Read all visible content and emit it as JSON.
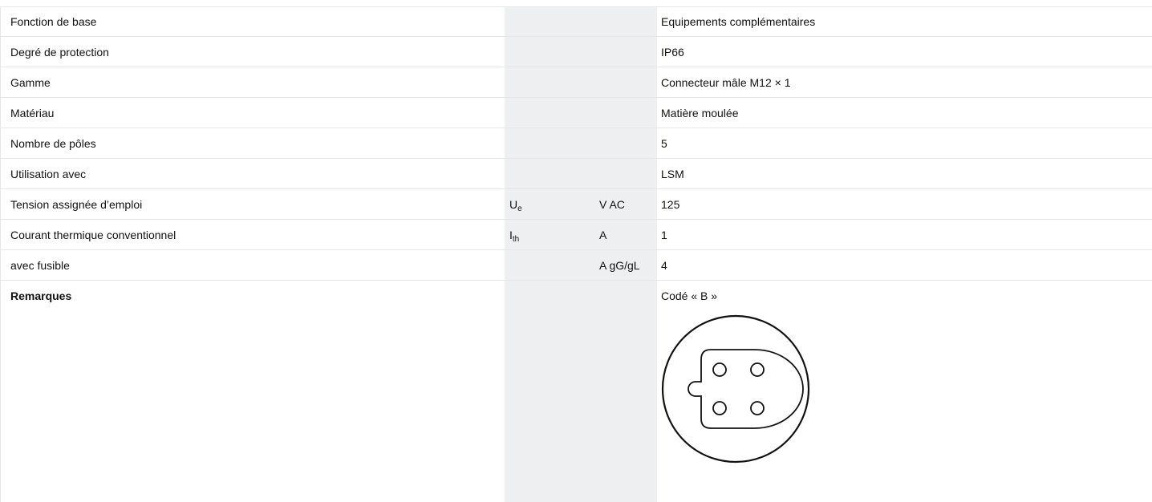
{
  "rows": [
    {
      "label": "Fonction de base",
      "value": "Equipements complémentaires"
    },
    {
      "label": "Degré de protection",
      "value": "IP66"
    },
    {
      "label": "Gamme",
      "value": "Connecteur mâle M12 × 1"
    },
    {
      "label": "Matériau",
      "value": "Matière moulée"
    },
    {
      "label": "Nombre de pôles",
      "value": "5"
    },
    {
      "label": "Utilisation avec",
      "value": "LSM"
    },
    {
      "label": "Tension assignée d’emploi",
      "symbol": "U",
      "symbol_sub": "e",
      "unit": "V AC",
      "value": "125"
    },
    {
      "label": "Courant thermique conventionnel",
      "symbol": "I",
      "symbol_sub": "th",
      "unit": "A",
      "value": "1"
    },
    {
      "label": "avec fusible",
      "unit": "A gG/gL",
      "value": "4"
    }
  ],
  "remarks": {
    "label": "Remarques",
    "value": "Codé « B »",
    "diagram_icon": "m12-connector-pin-layout-icon"
  },
  "colors": {
    "shaded_column": "#edeff1",
    "rule": "#e6e6e6",
    "text": "#111111"
  }
}
